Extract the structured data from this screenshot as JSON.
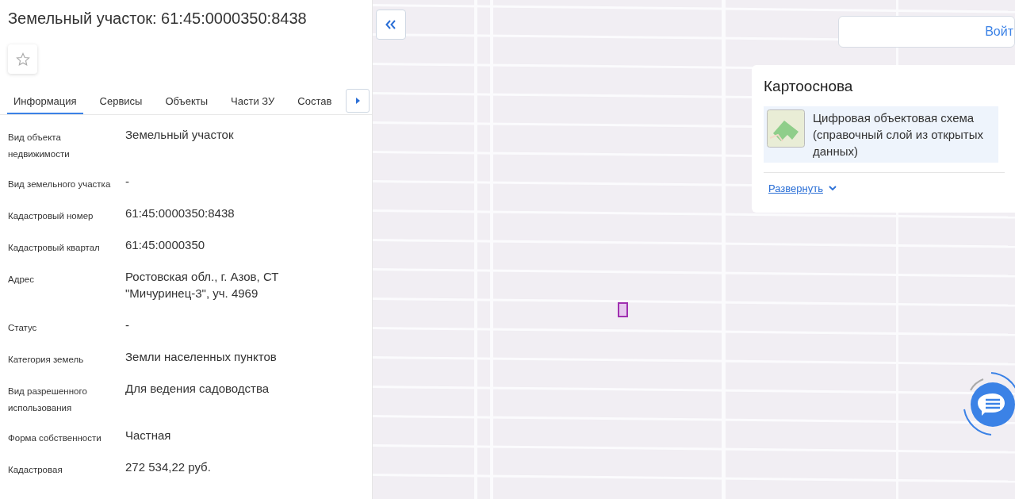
{
  "title": "Земельный участок: 61:45:0000350:8438",
  "favorite": {
    "selected": false
  },
  "tabs": [
    {
      "label": "Информация",
      "selected": true
    },
    {
      "label": "Сервисы",
      "selected": false
    },
    {
      "label": "Объекты",
      "selected": false
    },
    {
      "label": "Части ЗУ",
      "selected": false
    },
    {
      "label": "Состав",
      "selected": false
    }
  ],
  "fields": [
    {
      "label": "Вид объекта недвижимости",
      "value": "Земельный участок"
    },
    {
      "label": "Вид земельного участка",
      "value": "-"
    },
    {
      "label": "Кадастровый номер",
      "value": "61:45:0000350:8438"
    },
    {
      "label": "Кадастровый квартал",
      "value": "61:45:0000350"
    },
    {
      "label": "Адрес",
      "value": "Ростовская обл., г. Азов, СТ \"Мичуринец-3\", уч. 4969"
    },
    {
      "label": "Статус",
      "value": "-"
    },
    {
      "label": "Категория земель",
      "value": "Земли населенных пунктов"
    },
    {
      "label": "Вид разрешенного использования",
      "value": "Для ведения садоводства"
    },
    {
      "label": "Форма собственности",
      "value": "Частная"
    },
    {
      "label": "Кадастровая",
      "value": "272 534,22 руб."
    }
  ],
  "map": {
    "kind": "picture",
    "login_button": "Войт",
    "basemap_card": {
      "title": "Картооснова",
      "layer": "Цифровая объектовая схема (справочный слой из открытых данных)",
      "expand_link": "Развернуть"
    }
  }
}
